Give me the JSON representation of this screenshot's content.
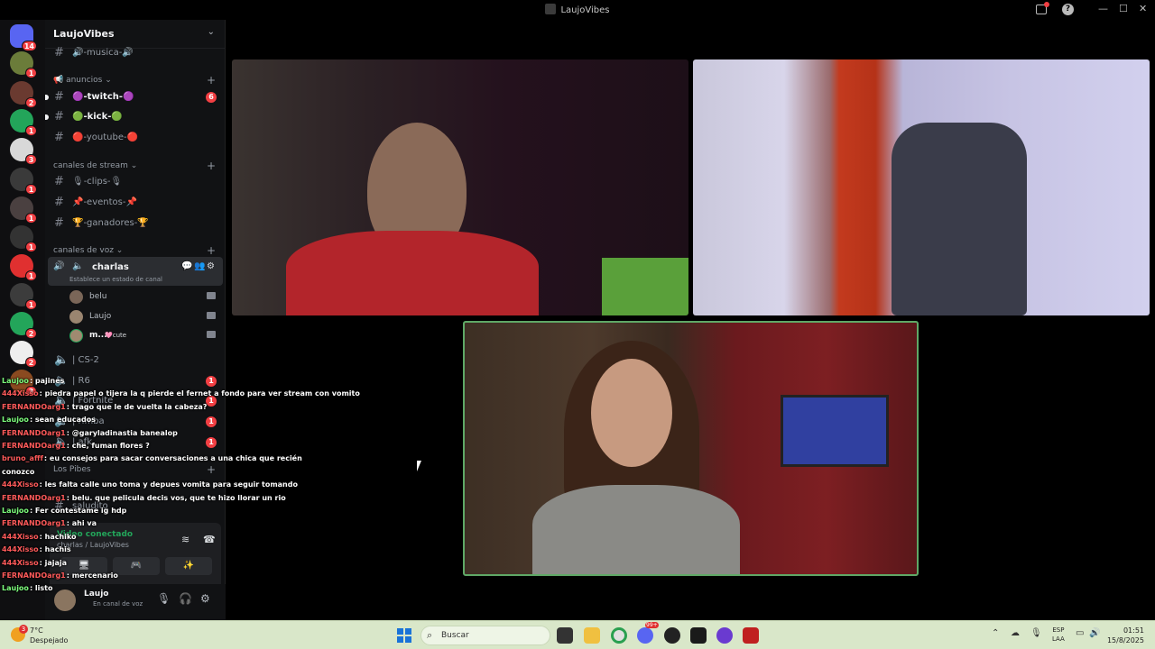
{
  "window": {
    "title": "LaujoVibes"
  },
  "servers": [
    {
      "badge": "14"
    },
    {
      "badge": "1"
    },
    {
      "badge": "2"
    },
    {
      "badge": "1"
    },
    {
      "badge": "3"
    },
    {
      "badge": "1"
    },
    {
      "badge": "1"
    },
    {
      "badge": "1"
    },
    {
      "badge": "1"
    },
    {
      "badge": "1"
    },
    {
      "badge": "2"
    },
    {
      "badge": "2"
    },
    {
      "badge": "3"
    }
  ],
  "guild": {
    "name": "LaujoVibes",
    "top_channel": "🔊-musica-🔊",
    "cat_anuncios": "📢 anuncios",
    "ch_twitch": "🟣-twitch-🟣",
    "ch_twitch_badge": "6",
    "ch_kick": "🟢-kick-🟢",
    "ch_youtube": "🔴-youtube-🔴",
    "cat_stream": "canales de stream",
    "ch_clips": "🎙-clips-🎙",
    "ch_eventos": "📌-eventos-📌",
    "ch_ganadores": "🏆-ganadores-🏆",
    "cat_voz": "canales de voz",
    "voice_channel": "charlas",
    "voice_status": "Establece un estado de canal",
    "voice_users": [
      {
        "name": "belu",
        "tag": ""
      },
      {
        "name": "Laujo",
        "tag": ""
      },
      {
        "name": "m...",
        "tag": "🩷cute"
      }
    ],
    "ch_cs2": "| CS-2",
    "ch_r6": "| R6",
    "ch_r6_badge": "1",
    "ch_fortnite": "| Fortnite",
    "ch_fortnite_badge": "1",
    "ch_rimba": "| rimba",
    "ch_rimba_badge": "1",
    "ch_afk": "| afk",
    "ch_afk_badge": "1",
    "cat_pibes": "Los Pibes",
    "ch_saludito": "saludito"
  },
  "voice_panel": {
    "status": "Video conectado",
    "where": "charlas / LaujoVibes"
  },
  "user": {
    "name": "Laujo",
    "status": "En canal de voz"
  },
  "chat": [
    {
      "user": "Laujoo",
      "text": ": pajines",
      "color": "#7cfc7c"
    },
    {
      "user": "444Xisso",
      "text": ": piedra papel o tijera la q pierde el fernet a fondo para ver stream con vomito",
      "color": "#ff5a5a"
    },
    {
      "user": "FERNANDOarg1",
      "text": ": trago que le de vuelta la cabeza?",
      "color": "#ff5a5a"
    },
    {
      "user": "Laujoo",
      "text": ": sean educados",
      "color": "#7cfc7c"
    },
    {
      "user": "FERNANDOarg1",
      "text": ": @garyladinastia banealop",
      "color": "#ff5a5a"
    },
    {
      "user": "FERNANDOarg1",
      "text": ": che, fuman flores ?",
      "color": "#ff5a5a"
    },
    {
      "user": "bruno_afff",
      "text": ": eu consejos para sacar conversaciones a una chica que recién",
      "color": "#ff5a5a"
    },
    {
      "user": "",
      "text": "conozco",
      "color": "#ffffff"
    },
    {
      "user": "444Xisso",
      "text": ": les falta calle uno toma y depues vomita para seguir tomando",
      "color": "#ff5a5a"
    },
    {
      "user": "FERNANDOarg1",
      "text": ": belu. que pelicula decis vos, que te hizo llorar un rio",
      "color": "#ff5a5a"
    },
    {
      "user": "Laujoo",
      "text": ": Fer contestame ig hdp",
      "color": "#7cfc7c"
    },
    {
      "user": "FERNANDOarg1",
      "text": ": ahi va",
      "color": "#ff5a5a"
    },
    {
      "user": "444Xisso",
      "text": ": hachiko",
      "color": "#ff5a5a"
    },
    {
      "user": "444Xisso",
      "text": ": hachis",
      "color": "#ff5a5a"
    },
    {
      "user": "444Xisso",
      "text": ": jajaja",
      "color": "#ff5a5a"
    },
    {
      "user": "FERNANDOarg1",
      "text": ": mercenario",
      "color": "#ff5a5a"
    },
    {
      "user": "Laujoo",
      "text": ": listo",
      "color": "#7cfc7c"
    }
  ],
  "taskbar": {
    "temp": "7°C",
    "condition": "Despejado",
    "weather_badge": "3",
    "search_placeholder": "Buscar",
    "lang1": "ESP",
    "lang2": "LAA",
    "time": "01:51",
    "date": "15/8/2025",
    "discord_badge": "99+"
  },
  "colors": {
    "accent_green": "#23a55a",
    "badge_red": "#f23f43",
    "speaking_border": "#5fa866"
  }
}
